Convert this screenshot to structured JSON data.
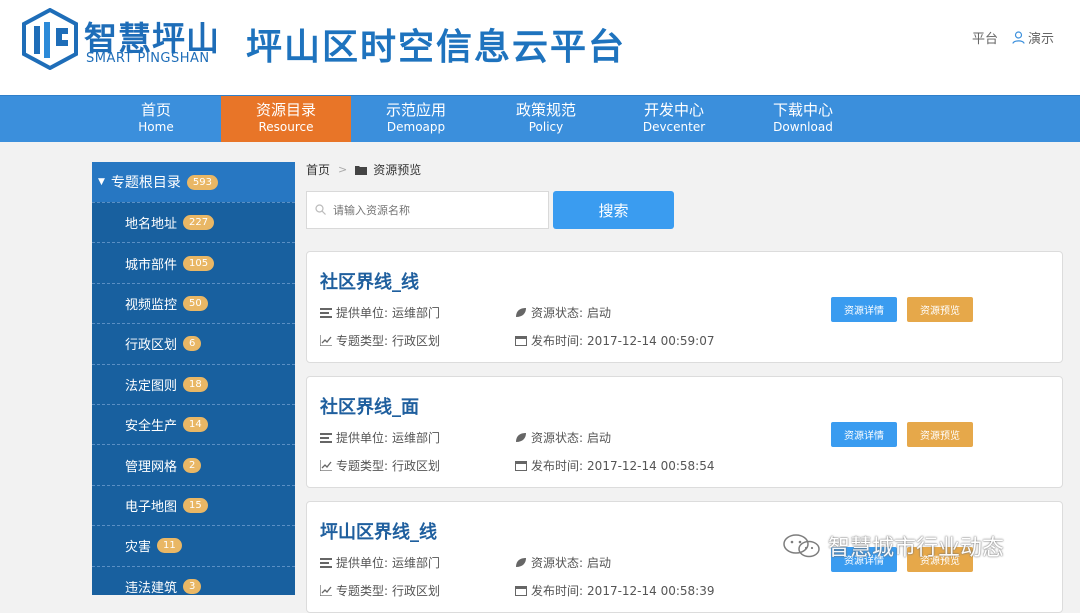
{
  "header": {
    "logo_cn": "智慧坪山",
    "logo_en": "SMART PINGSHAN",
    "site_title": "坪山区时空信息云平台",
    "links": {
      "platform": "平台",
      "demo": "演示"
    },
    "brand_color": "#1e73be"
  },
  "nav": {
    "items": [
      {
        "cn": "首页",
        "en": "Home"
      },
      {
        "cn": "资源目录",
        "en": "Resource"
      },
      {
        "cn": "示范应用",
        "en": "Demoapp"
      },
      {
        "cn": "政策规范",
        "en": "Policy"
      },
      {
        "cn": "开发中心",
        "en": "Devcenter"
      },
      {
        "cn": "下载中心",
        "en": "Download"
      }
    ],
    "active_index": 1,
    "bar_color": "#3b8fdc",
    "active_color": "#e87528"
  },
  "sidebar": {
    "root": {
      "label": "专题根目录",
      "count": "593"
    },
    "items": [
      {
        "label": "地名地址",
        "count": "227"
      },
      {
        "label": "城市部件",
        "count": "105"
      },
      {
        "label": "视频监控",
        "count": "50"
      },
      {
        "label": "行政区划",
        "count": "6"
      },
      {
        "label": "法定图则",
        "count": "18"
      },
      {
        "label": "安全生产",
        "count": "14"
      },
      {
        "label": "管理网格",
        "count": "2"
      },
      {
        "label": "电子地图",
        "count": "15"
      },
      {
        "label": "灾害",
        "count": "11"
      },
      {
        "label": "违法建筑",
        "count": "3"
      }
    ]
  },
  "breadcrumb": {
    "home": "首页",
    "current": "资源预览"
  },
  "search": {
    "placeholder": "请输入资源名称",
    "button": "搜索"
  },
  "labels": {
    "provider": "提供单位:",
    "status": "资源状态:",
    "type": "专题类型:",
    "publish": "发布时间:",
    "detail_button": "资源详情",
    "preview_button": "资源预览"
  },
  "cards": [
    {
      "title": "社区界线_线",
      "provider": "运维部门",
      "status": "启动",
      "type": "行政区划",
      "time": "2017-12-14 00:59:07"
    },
    {
      "title": "社区界线_面",
      "provider": "运维部门",
      "status": "启动",
      "type": "行政区划",
      "time": "2017-12-14 00:58:54"
    },
    {
      "title": "坪山区界线_线",
      "provider": "运维部门",
      "status": "启动",
      "type": "行政区划",
      "time": "2017-12-14 00:58:39"
    }
  ],
  "watermark": {
    "text": "智慧城市行业动态"
  }
}
